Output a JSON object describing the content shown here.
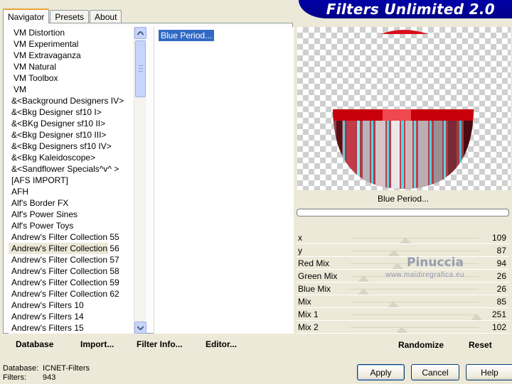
{
  "tabs": [
    {
      "label": "Navigator"
    },
    {
      "label": "Presets"
    },
    {
      "label": "About"
    }
  ],
  "banner": {
    "title": "Filters Unlimited 2.0"
  },
  "categories": [
    "VM Distortion",
    "VM Experimental",
    "VM Extravaganza",
    "VM Natural",
    "VM Toolbox",
    "VM",
    "&<Background Designers IV>",
    "&<Bkg Designer sf10 I>",
    "&<BKg Designer sf10 II>",
    "&<Bkg Designer sf10 III>",
    "&<Bkg Designers sf10 IV>",
    "&<Bkg Kaleidoscope>",
    "&<Sandflower Specials^v^ >",
    "[AFS IMPORT]",
    "AFH",
    "Alf's Border FX",
    "Alf's Power Sines",
    "Alf's Power Toys",
    "Andrew's Filter Collection 55",
    "Andrew's Filter Collection 56",
    "Andrew's Filter Collection 57",
    "Andrew's Filter Collection 58",
    "Andrew's Filter Collection 59",
    "Andrew's Filter Collection 62",
    "Andrew's Filters 10",
    "Andrew's Filters 14",
    "Andrew's Filters 15"
  ],
  "selected_category_index": 19,
  "filters": [
    {
      "label": "Blue Period..."
    }
  ],
  "left_buttons": {
    "database": "Database",
    "import": "Import...",
    "filter_info": "Filter Info...",
    "editor": "Editor..."
  },
  "preview": {
    "filter_name": "Blue Period...",
    "progress": 0
  },
  "params": [
    {
      "label": "x",
      "value": "109"
    },
    {
      "label": "y",
      "value": "87"
    },
    {
      "label": "Red Mix",
      "value": "94"
    },
    {
      "label": "Green Mix",
      "value": "26"
    },
    {
      "label": "Blue Mix",
      "value": "26"
    },
    {
      "label": "Mix",
      "value": "85"
    },
    {
      "label": "Mix 1",
      "value": "251"
    },
    {
      "label": "Mix 2",
      "value": "102"
    }
  ],
  "watermark": {
    "name": "Pinuccia",
    "url": "www.maidiregrafica.eu"
  },
  "right_buttons": {
    "randomize": "Randomize",
    "reset": "Reset"
  },
  "footer": {
    "database_label": "Database:",
    "database_value": "ICNET-Filters",
    "filters_label": "Filters:",
    "filters_value": "943",
    "apply": "Apply",
    "cancel": "Cancel",
    "help": "Help"
  },
  "colors": {
    "banner": "#0000a0",
    "selection": "#316ac5",
    "accent_red": "#c8000c",
    "accent_cyan": "#3ce0e0"
  }
}
